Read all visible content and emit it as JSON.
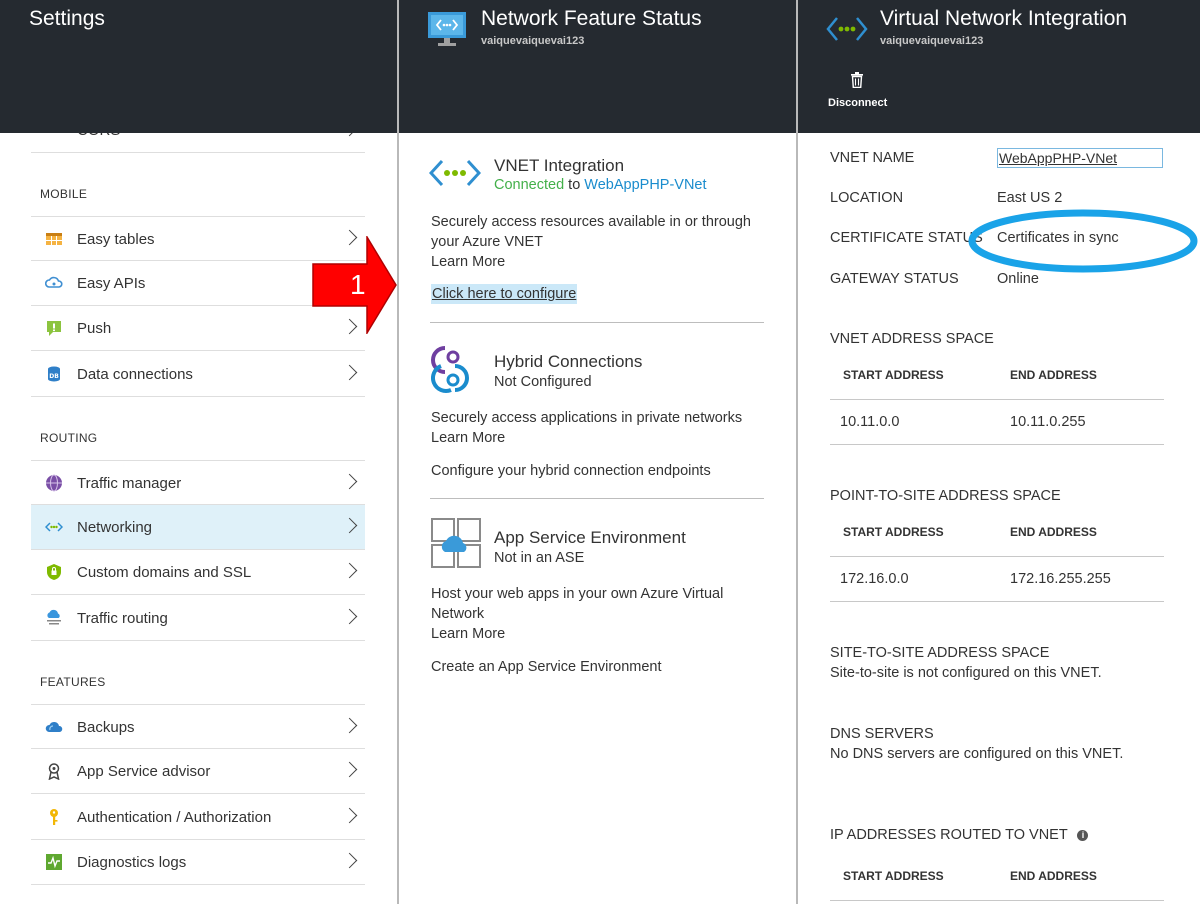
{
  "settings": {
    "title": "Settings",
    "top_partial_label": "CORS",
    "sections": {
      "mobile": "MOBILE",
      "routing": "ROUTING",
      "features": "FEATURES"
    },
    "items": [
      {
        "label": "Easy tables"
      },
      {
        "label": "Easy APIs"
      },
      {
        "label": "Push"
      },
      {
        "label": "Data connections"
      },
      {
        "label": "Traffic manager"
      },
      {
        "label": "Networking"
      },
      {
        "label": "Custom domains and SSL"
      },
      {
        "label": "Traffic routing"
      },
      {
        "label": "Backups"
      },
      {
        "label": "App Service advisor"
      },
      {
        "label": "Authentication / Authorization"
      },
      {
        "label": "Diagnostics logs"
      }
    ]
  },
  "annotation": {
    "number": "1",
    "arrow_color": "#ff0000",
    "circle_color": "#1aa3e8"
  },
  "nfs": {
    "title": "Network Feature Status",
    "subtitle": "vaiquevaiquevai123",
    "vnet": {
      "title": "VNET Integration",
      "status": "Connected",
      "to": "to",
      "target": "WebAppPHP-VNet",
      "desc": "Securely access resources available in or through your Azure VNET",
      "learn_more": "Learn More",
      "configure": "Click here to configure"
    },
    "hybrid": {
      "title": "Hybrid Connections",
      "status": "Not Configured",
      "desc": "Securely access applications in private networks",
      "learn_more": "Learn More",
      "configure": "Configure your hybrid connection endpoints"
    },
    "ase": {
      "title": "App Service Environment",
      "status": "Not in an ASE",
      "desc": "Host your web apps in your own Azure Virtual Network",
      "learn_more": "Learn More",
      "create": "Create an App Service Environment"
    }
  },
  "vni": {
    "title": "Virtual Network Integration",
    "subtitle": "vaiquevaiquevai123",
    "disconnect": "Disconnect",
    "props": {
      "vnet_name_label": "VNET NAME",
      "vnet_name_value": "WebAppPHP-VNet",
      "location_label": "LOCATION",
      "location_value": "East US 2",
      "cert_label": "CERTIFICATE STATUS",
      "cert_value": "Certificates in sync",
      "gateway_label": "GATEWAY STATUS",
      "gateway_value": "Online"
    },
    "vnet_space": {
      "title": "VNET ADDRESS SPACE",
      "start_header": "START ADDRESS",
      "end_header": "END ADDRESS",
      "start": "10.11.0.0",
      "end": "10.11.0.255"
    },
    "p2s": {
      "title": "POINT-TO-SITE ADDRESS SPACE",
      "start_header": "START ADDRESS",
      "end_header": "END ADDRESS",
      "start": "172.16.0.0",
      "end": "172.16.255.255"
    },
    "s2s": {
      "title": "SITE-TO-SITE ADDRESS SPACE",
      "desc": "Site-to-site is not configured on this VNET."
    },
    "dns": {
      "title": "DNS SERVERS",
      "desc": "No DNS servers are configured on this VNET."
    },
    "routed": {
      "title": "IP ADDRESSES ROUTED TO VNET",
      "start_header": "START ADDRESS",
      "end_header": "END ADDRESS"
    }
  }
}
